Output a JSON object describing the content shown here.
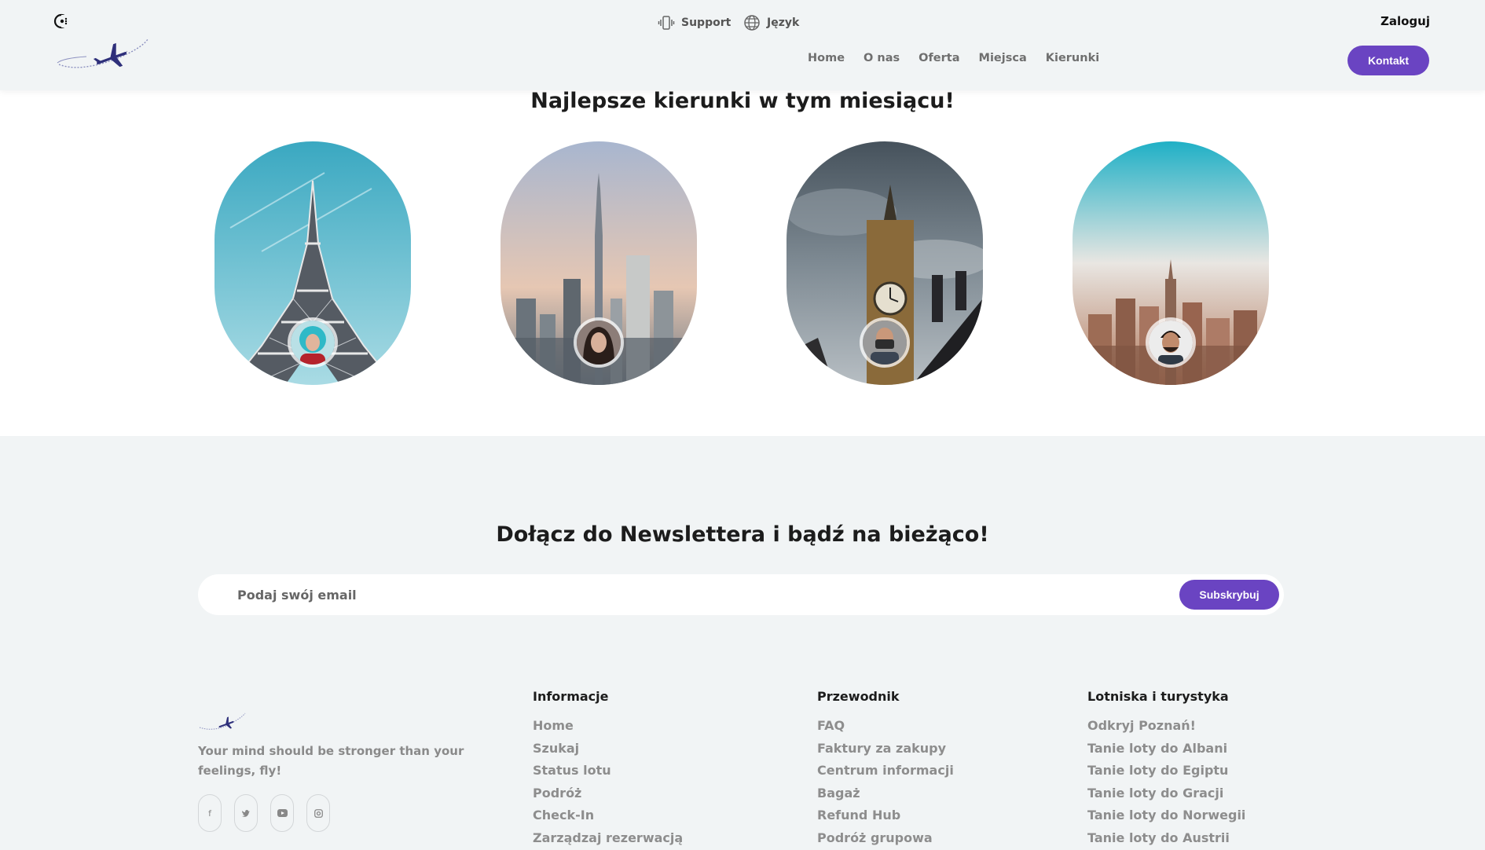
{
  "header": {
    "support_label": "Support",
    "language_label": "Język",
    "login_label": "Zaloguj",
    "nav": [
      "Home",
      "O nas",
      "Oferta",
      "Miejsca",
      "Kierunki"
    ],
    "contact_label": "Kontakt",
    "accent_color": "#6a44c2"
  },
  "destinations": {
    "title": "Najlepsze kierunki w tym miesiącu!",
    "cards": [
      {
        "scene": "eiffel-tower",
        "avatar": "woman-teal-hair"
      },
      {
        "scene": "dubai-skyline",
        "avatar": "woman-dark-hair"
      },
      {
        "scene": "big-ben",
        "avatar": "man-with-camera"
      },
      {
        "scene": "new-york-skyline",
        "avatar": "man-smiling"
      }
    ]
  },
  "newsletter": {
    "title": "Dołącz do Newslettera i bądź na bieżąco!",
    "placeholder": "Podaj swój email",
    "button_label": "Subskrybuj"
  },
  "footer": {
    "tagline": "Your mind should be stronger than your feelings, fly!",
    "socials": [
      "facebook-icon",
      "twitter-icon",
      "youtube-icon",
      "instagram-icon"
    ],
    "columns": [
      {
        "heading": "Informacje",
        "links": [
          "Home",
          "Szukaj",
          "Status lotu",
          "Podróż",
          "Check-In",
          "Zarządzaj rezerwacją"
        ]
      },
      {
        "heading": "Przewodnik",
        "links": [
          "FAQ",
          "Faktury za zakupy",
          "Centrum informacji",
          "Bagaż",
          "Refund Hub",
          "Podróż grupowa"
        ]
      },
      {
        "heading": "Lotniska i turystyka",
        "links": [
          "Odkryj Poznań!",
          "Tanie loty do Albani",
          "Tanie loty do Egiptu",
          "Tanie loty do Gracji",
          "Tanie loty do Norwegii",
          "Tanie loty do Austrii"
        ]
      }
    ]
  }
}
